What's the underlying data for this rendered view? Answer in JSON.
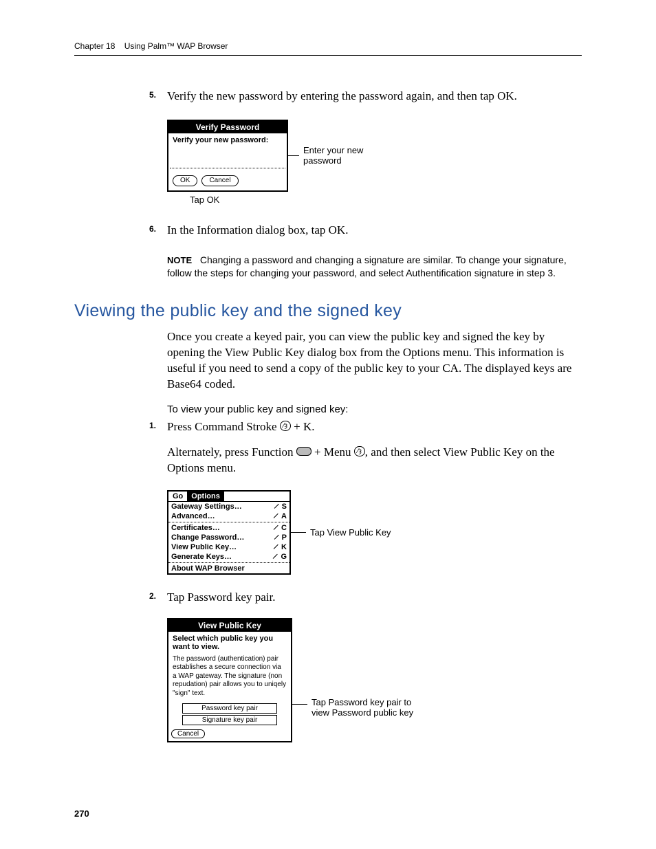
{
  "header": {
    "chapter": "Chapter 18",
    "title": "Using Palm™ WAP Browser"
  },
  "step5": {
    "num": "5.",
    "text": "Verify the new password by entering the password again, and then tap OK."
  },
  "verify_dialog": {
    "title": "Verify Password",
    "prompt": "Verify your new password:",
    "ok": "OK",
    "cancel": "Cancel"
  },
  "callout1": {
    "line1": "Enter your new",
    "line2": "password",
    "below": "Tap OK"
  },
  "step6": {
    "num": "6.",
    "text": "In the Information dialog box, tap OK."
  },
  "note": {
    "label": "NOTE",
    "text": "Changing a password and changing a signature are similar. To change your signature, follow the steps for changing your password, and select Authentification signature in step 3."
  },
  "section_title": "Viewing the public key and the signed key",
  "section_body": "Once you create a keyed pair, you can view the public key and signed the key by opening the View Public Key dialog box from the Options menu. This information is useful if you need to send a copy of the public key to your CA. The displayed keys are Base64 coded.",
  "subhead": "To view your public key and signed key:",
  "vstep1": {
    "num": "1.",
    "pre": "Press Command Stroke ",
    "post": " + K.",
    "alt_pre": "Alternately, press Function ",
    "alt_mid": " + Menu ",
    "alt_post": ", and then select View Public Key on the Options menu."
  },
  "menu": {
    "go": "Go",
    "options": "Options",
    "items": [
      {
        "label": "Gateway Settings…",
        "sc": "S"
      },
      {
        "label": "Advanced…",
        "sc": "A"
      },
      {
        "sep": true
      },
      {
        "label": "Certificates…",
        "sc": "C"
      },
      {
        "label": "Change Password…",
        "sc": "P"
      },
      {
        "label": "View Public Key…",
        "sc": "K"
      },
      {
        "label": "Generate Keys…",
        "sc": "G"
      },
      {
        "sep": true
      },
      {
        "label": "About WAP Browser",
        "sc": ""
      }
    ]
  },
  "callout2": "Tap View Public Key",
  "vstep2": {
    "num": "2.",
    "text": "Tap Password key pair."
  },
  "view_dialog": {
    "title": "View Public Key",
    "prompt": "Select which public key you want to view.",
    "desc": "The password (authentication) pair establishes a secure connection via a WAP gateway. The signature (non repudation) pair allows you to uniqely \"sign\" text.",
    "row1": "Password key pair",
    "row2": "Signature key pair",
    "cancel": "Cancel"
  },
  "callout3": {
    "l1": "Tap Password key pair to",
    "l2": "view Password public key"
  },
  "pagenum": "270"
}
